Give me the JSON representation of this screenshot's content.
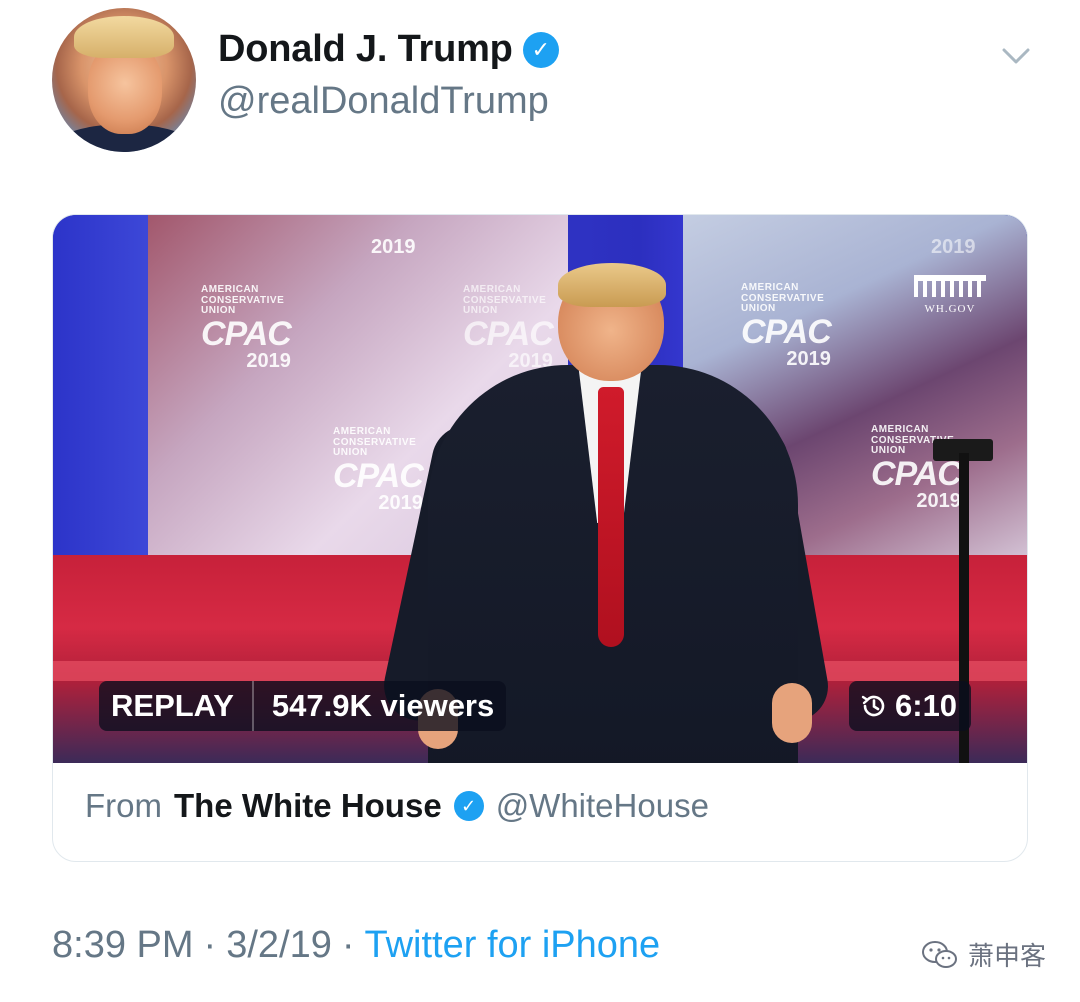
{
  "header": {
    "display_name": "Donald J. Trump",
    "handle": "@realDonaldTrump",
    "verified_icon": "verified-badge-icon",
    "more_icon": "chevron-down-icon"
  },
  "video": {
    "status_label": "REPLAY",
    "viewers_label": "547.9K viewers",
    "duration": "6:10",
    "clock_icon": "history-clock-icon",
    "backdrop_logos": [
      {
        "acu": "AMERICAN\nCONSERVATIVE\nUNION",
        "cpac": "CPAC",
        "year": "2019"
      },
      {
        "acu": "AMERICAN\nCONSERVATIVE\nUNION",
        "cpac": "CPAC",
        "year": "2019"
      },
      {
        "acu": "AMERICAN\nCONSERVATIVE\nUNION",
        "cpac": "CPAC",
        "year": "2019"
      },
      {
        "acu": "AMERICAN\nCONSERVATIVE\nUNION",
        "cpac": "CPAC",
        "year": "2019"
      },
      {
        "acu": "AMERICAN\nCONSERVATIVE\nUNION",
        "cpac": "CPAC",
        "year": "2019"
      }
    ],
    "top_year_left": "2019",
    "top_year_right": "2019",
    "wh_label": "WH.GOV"
  },
  "source": {
    "from_label": "From",
    "org_name": "The White House",
    "org_handle": "@WhiteHouse"
  },
  "meta": {
    "time": "8:39 PM",
    "separator": "·",
    "date": "3/2/19",
    "app": "Twitter for iPhone"
  },
  "watermark": {
    "text": "萧申客",
    "icon": "wechat-icon"
  },
  "colors": {
    "link": "#1da1f2",
    "muted": "#657786",
    "text": "#14171a"
  }
}
